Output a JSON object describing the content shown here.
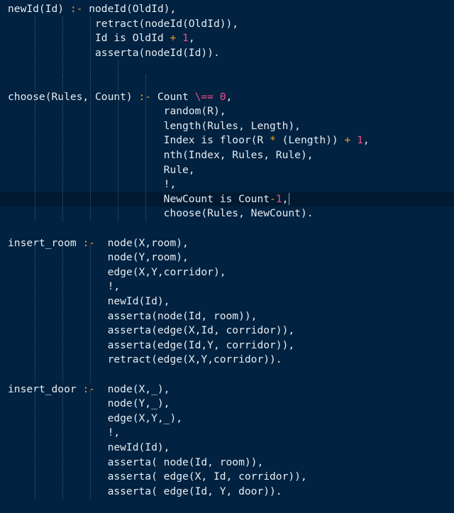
{
  "editor": {
    "language": "prolog",
    "colors": {
      "background": "#012240",
      "current_line": "#011a31",
      "text": "#e6edf3",
      "operator": "#f0a030",
      "number": "#f2508a"
    },
    "cursor_line": 13,
    "lines": [
      [
        {
          "t": "newId(Id) "
        },
        {
          "t": ":-",
          "c": "op"
        },
        {
          "t": " nodeId(OldId),"
        }
      ],
      [
        {
          "t": "              retract(nodeId(OldId)),"
        }
      ],
      [
        {
          "t": "              Id is OldId "
        },
        {
          "t": "+",
          "c": "op"
        },
        {
          "t": " "
        },
        {
          "t": "1",
          "c": "num"
        },
        {
          "t": ","
        }
      ],
      [
        {
          "t": "              asserta(nodeId(Id))."
        }
      ],
      [],
      [],
      [
        {
          "t": "choose(Rules, Count) "
        },
        {
          "t": ":-",
          "c": "op"
        },
        {
          "t": " Count "
        },
        {
          "t": "\\==",
          "c": "num"
        },
        {
          "t": " "
        },
        {
          "t": "0",
          "c": "num"
        },
        {
          "t": ","
        }
      ],
      [
        {
          "t": "                         random(R),"
        }
      ],
      [
        {
          "t": "                         length(Rules, Length),"
        }
      ],
      [
        {
          "t": "                         Index is floor(R "
        },
        {
          "t": "*",
          "c": "op"
        },
        {
          "t": " (Length)) "
        },
        {
          "t": "+",
          "c": "op"
        },
        {
          "t": " "
        },
        {
          "t": "1",
          "c": "num"
        },
        {
          "t": ","
        }
      ],
      [
        {
          "t": "                         nth(Index, Rules, Rule),"
        }
      ],
      [
        {
          "t": "                         Rule,"
        }
      ],
      [
        {
          "t": "                         !,"
        }
      ],
      [
        {
          "t": "                         NewCount is Count"
        },
        {
          "t": "-",
          "c": "op"
        },
        {
          "t": "1",
          "c": "num"
        },
        {
          "t": ","
        }
      ],
      [
        {
          "t": "                         choose(Rules, NewCount)."
        }
      ],
      [],
      [
        {
          "t": "insert_room "
        },
        {
          "t": ":-",
          "c": "op"
        },
        {
          "t": "  node(X,room),"
        }
      ],
      [
        {
          "t": "                node(Y,room),"
        }
      ],
      [
        {
          "t": "                edge(X,Y,corridor),"
        }
      ],
      [
        {
          "t": "                !,"
        }
      ],
      [
        {
          "t": "                newId(Id),"
        }
      ],
      [
        {
          "t": "                asserta(node(Id, room)),"
        }
      ],
      [
        {
          "t": "                asserta(edge(X,Id, corridor)),"
        }
      ],
      [
        {
          "t": "                asserta(edge(Id,Y, corridor)),"
        }
      ],
      [
        {
          "t": "                retract(edge(X,Y,corridor))."
        }
      ],
      [],
      [
        {
          "t": "insert_door "
        },
        {
          "t": ":-",
          "c": "op"
        },
        {
          "t": "  node(X,_),"
        }
      ],
      [
        {
          "t": "                node(Y,_),"
        }
      ],
      [
        {
          "t": "                edge(X,Y,_),"
        }
      ],
      [
        {
          "t": "                !,"
        }
      ],
      [
        {
          "t": "                newId(Id),"
        }
      ],
      [
        {
          "t": "                asserta( node(Id, room)),"
        }
      ],
      [
        {
          "t": "                asserta( edge(X, Id, corridor)),"
        }
      ],
      [
        {
          "t": "                asserta( edge(Id, Y, door))."
        }
      ]
    ]
  }
}
